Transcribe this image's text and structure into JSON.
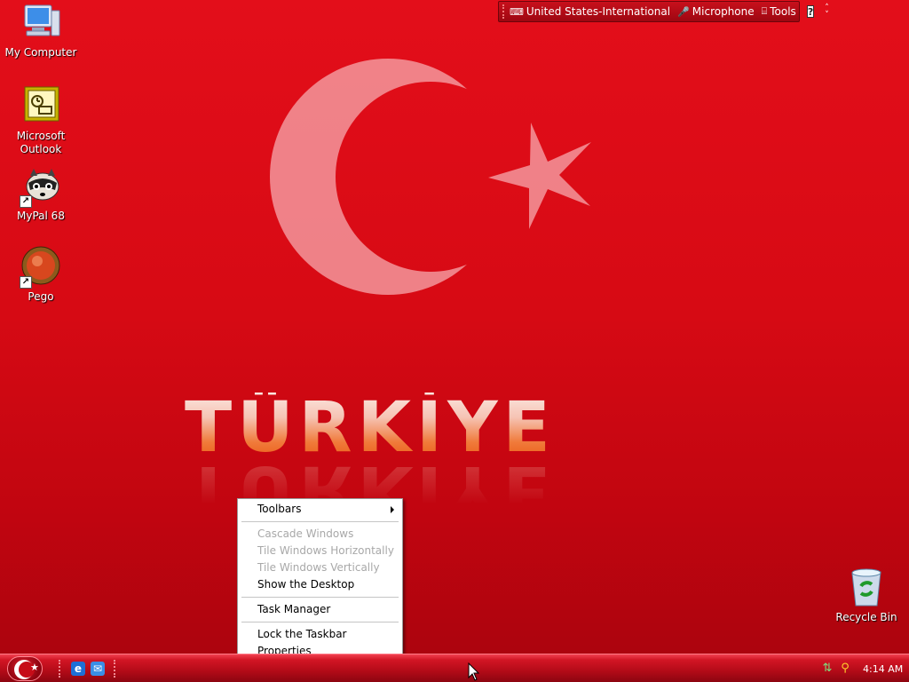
{
  "desktop": {
    "icons": [
      {
        "label": "My Computer",
        "icon": "computer-icon"
      },
      {
        "label": "Microsoft Outlook",
        "icon": "outlook-icon"
      },
      {
        "label": "MyPal 68",
        "icon": "mypal-icon"
      },
      {
        "label": "Pego",
        "icon": "pego-icon"
      },
      {
        "label": "Recycle Bin",
        "icon": "recycle-bin-icon"
      }
    ],
    "wallpaper_text": "TÜRKİYE"
  },
  "language_bar": {
    "language": "United States-International",
    "microphone": "Microphone",
    "tools": "Tools",
    "help": "?"
  },
  "context_menu": {
    "items": [
      {
        "label": "Toolbars",
        "enabled": true,
        "submenu": true
      },
      {
        "label": "Cascade Windows",
        "enabled": false
      },
      {
        "label": "Tile Windows Horizontally",
        "enabled": false
      },
      {
        "label": "Tile Windows Vertically",
        "enabled": false
      },
      {
        "label": "Show the Desktop",
        "enabled": true
      },
      {
        "label": "Task Manager",
        "enabled": true
      },
      {
        "label": "Lock the Taskbar",
        "enabled": true
      },
      {
        "label": "Properties",
        "enabled": true
      }
    ]
  },
  "taskbar": {
    "clock": "4:14 AM",
    "quick_launch": [
      "internet-explorer-icon",
      "outlook-express-icon"
    ],
    "tray": [
      "network-icon",
      "search-icon"
    ]
  },
  "colors": {
    "desktop_red": "#d70a14",
    "taskbar_red": "#b30b18",
    "menu_bg": "#ffffff",
    "disabled_text": "#a8a8a8"
  }
}
